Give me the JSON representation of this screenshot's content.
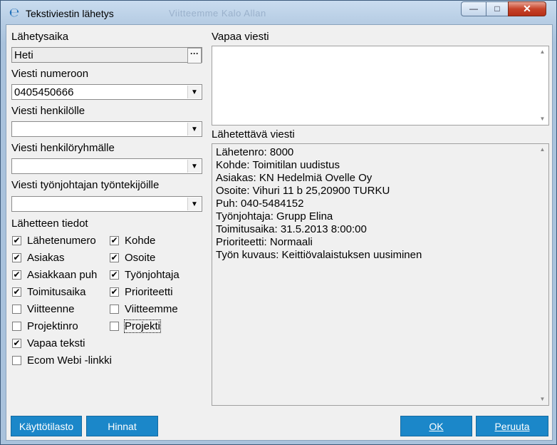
{
  "window": {
    "title": "Tekstiviestin lähetys",
    "background_title": "Viitteemme Kalo Allan",
    "controls": {
      "minimize": "—",
      "maximize": "□",
      "close": "✕"
    }
  },
  "left": {
    "send_time": {
      "label": "Lähetysaika",
      "value": "Heti",
      "button": "···"
    },
    "number": {
      "label": "Viesti numeroon",
      "value": "0405450666"
    },
    "person": {
      "label": "Viesti henkilölle",
      "value": ""
    },
    "group": {
      "label": "Viesti henkilöryhmälle",
      "value": ""
    },
    "workers": {
      "label": "Viesti työnjohtajan työntekijöille",
      "value": ""
    },
    "source_info_label": "Lähetteen tiedot",
    "checkboxes": [
      {
        "label": "Lähetenumero",
        "checked": true
      },
      {
        "label": "Kohde",
        "checked": true
      },
      {
        "label": "Asiakas",
        "checked": true
      },
      {
        "label": "Osoite",
        "checked": true
      },
      {
        "label": "Asiakkaan puh",
        "checked": true
      },
      {
        "label": "Työnjohtaja",
        "checked": true
      },
      {
        "label": "Toimitusaika",
        "checked": true
      },
      {
        "label": "Prioriteetti",
        "checked": true
      },
      {
        "label": "Viitteenne",
        "checked": false
      },
      {
        "label": "Viitteemme",
        "checked": false
      },
      {
        "label": "Projektinro",
        "checked": false
      },
      {
        "label": "Projekti",
        "checked": false
      },
      {
        "label": "Vapaa teksti",
        "checked": true
      },
      {
        "label": "Ecom Webi -linkki",
        "checked": false
      }
    ]
  },
  "right": {
    "free_message": {
      "label": "Vapaa viesti",
      "value": ""
    },
    "message_to_send": {
      "label": "Lähetettävä viesti",
      "lines": [
        "Lähetenro: 8000",
        "Kohde: Toimitilan uudistus",
        "Asiakas: KN Hedelmiä Ovelle Oy",
        "Osoite: Vihuri 11 b 25,20900 TURKU",
        "Puh: 040-5484152",
        "Työnjohtaja: Grupp Elina",
        "Toimitusaika: 31.5.2013 8:00:00",
        "Prioriteetti: Normaali",
        "Työn kuvaus: Keittiövalaistuksen uusiminen"
      ]
    }
  },
  "buttons": {
    "usage_stats": "Käyttötilasto",
    "prices": "Hinnat",
    "ok": "OK",
    "cancel": "Peruuta"
  },
  "colors": {
    "button_bg": "#1b87c9",
    "title_gradient": "#b7cde4"
  }
}
